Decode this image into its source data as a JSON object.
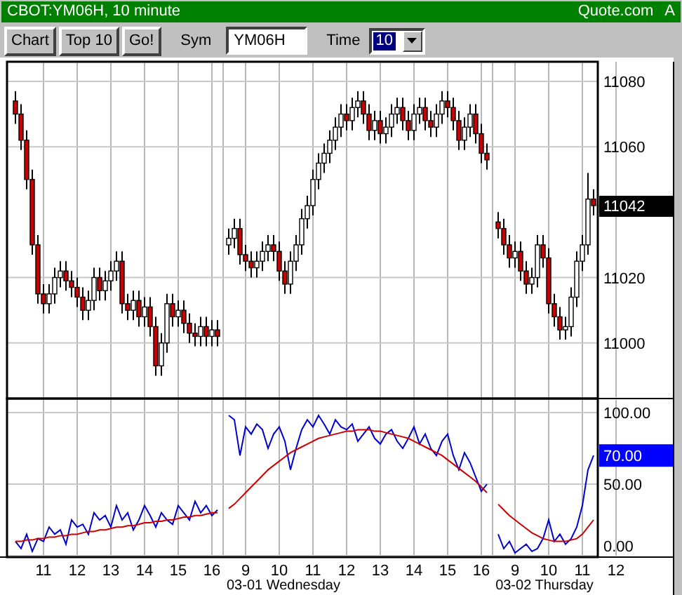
{
  "window": {
    "title": "CBOT:YM06H, 10 minute",
    "brand": "Quote.com",
    "brand_suffix": "A"
  },
  "toolbar": {
    "buttons": [
      "Chart",
      "Top 10",
      "Go!"
    ],
    "sym_label": "Sym",
    "sym_value": "YM06H",
    "time_label": "Time",
    "time_value": "10"
  },
  "price_chart": {
    "chart_data": {
      "type": "candlestick",
      "grid": true,
      "yticks": [
        11000,
        11020,
        11060,
        11080
      ],
      "ylim": [
        10983,
        11086
      ],
      "categories": [
        null,
        null,
        null,
        null,
        null,
        null,
        null,
        null,
        null,
        null,
        null,
        null,
        null,
        null,
        null,
        null,
        null,
        null,
        null,
        null,
        null,
        null,
        null,
        null,
        null,
        null,
        null,
        null,
        null,
        null,
        null,
        null,
        null,
        null,
        null,
        null,
        null,
        null,
        null,
        null,
        null,
        null,
        null,
        null,
        null,
        null,
        null,
        null,
        null,
        null,
        null,
        null,
        null,
        null,
        null,
        null,
        null,
        null,
        null,
        null,
        null,
        null,
        null,
        null,
        null,
        null,
        null,
        null,
        null,
        null,
        null,
        null,
        null,
        null,
        null,
        null,
        null,
        null,
        null,
        null,
        null,
        null,
        null,
        null,
        null,
        null,
        null,
        null,
        null,
        null,
        null,
        null,
        null,
        null,
        null,
        null,
        null,
        null,
        null,
        null,
        null,
        null,
        null,
        null,
        null,
        null,
        null,
        null
      ],
      "ohlc": [
        [
          11074,
          11077,
          11067,
          11070
        ],
        [
          11070,
          11073,
          11059,
          11062
        ],
        [
          11062,
          11065,
          11047,
          11050
        ],
        [
          11050,
          11053,
          11027,
          11030
        ],
        [
          11030,
          11033,
          11012,
          11015
        ],
        [
          11015,
          11018,
          11009,
          11012
        ],
        [
          11012,
          11018,
          11009,
          11015
        ],
        [
          11015,
          11023,
          11012,
          11020
        ],
        [
          11020,
          11025,
          11017,
          11022
        ],
        [
          11022,
          11025,
          11016,
          11019
        ],
        [
          11019,
          11022,
          11014,
          11017
        ],
        [
          11017,
          11020,
          11011,
          11014
        ],
        [
          11014,
          11017,
          11007,
          11010
        ],
        [
          11010,
          11016,
          11007,
          11013
        ],
        [
          11013,
          11023,
          11010,
          11020
        ],
        [
          11020,
          11023,
          11013,
          11016
        ],
        [
          11016,
          11022,
          11013,
          11019
        ],
        [
          11019,
          11025,
          11016,
          11022
        ],
        [
          11022,
          11028,
          11019,
          11025
        ],
        [
          11025,
          11028,
          11009,
          11012
        ],
        [
          11012,
          11015,
          11007,
          11010
        ],
        [
          11010,
          11016,
          11007,
          11013
        ],
        [
          11013,
          11016,
          11005,
          11008
        ],
        [
          11008,
          11014,
          11005,
          11011
        ],
        [
          11011,
          11014,
          11002,
          11005
        ],
        [
          11005,
          11008,
          10990,
          10993
        ],
        [
          10993,
          11003,
          10990,
          11000
        ],
        [
          11000,
          11015,
          10997,
          11012
        ],
        [
          11012,
          11015,
          11005,
          11008
        ],
        [
          11008,
          11013,
          11005,
          11010
        ],
        [
          11010,
          11013,
          11003,
          11006
        ],
        [
          11006,
          11009,
          11000,
          11003
        ],
        [
          11003,
          11006,
          10999,
          11002
        ],
        [
          11002,
          11008,
          10999,
          11005
        ],
        [
          11005,
          11008,
          10999,
          11002
        ],
        [
          11002,
          11007,
          10999,
          11004
        ],
        [
          11004,
          11007,
          10999,
          11002
        ],
        null,
        [
          11030,
          11035,
          11027,
          11032
        ],
        [
          11032,
          11038,
          11029,
          11035
        ],
        [
          11035,
          11038,
          11024,
          11027
        ],
        [
          11027,
          11030,
          11022,
          11025
        ],
        [
          11025,
          11028,
          11020,
          11023
        ],
        [
          11023,
          11028,
          11020,
          11025
        ],
        [
          11025,
          11031,
          11022,
          11028
        ],
        [
          11028,
          11033,
          11025,
          11030
        ],
        [
          11030,
          11033,
          11025,
          11028
        ],
        [
          11028,
          11031,
          11019,
          11022
        ],
        [
          11022,
          11025,
          11015,
          11018
        ],
        [
          11018,
          11028,
          11015,
          11025
        ],
        [
          11025,
          11033,
          11022,
          11030
        ],
        [
          11030,
          11041,
          11027,
          11038
        ],
        [
          11038,
          11045,
          11035,
          11042
        ],
        [
          11042,
          11053,
          11039,
          11050
        ],
        [
          11050,
          11058,
          11047,
          11055
        ],
        [
          11055,
          11061,
          11052,
          11058
        ],
        [
          11058,
          11065,
          11055,
          11062
        ],
        [
          11062,
          11069,
          11059,
          11066
        ],
        [
          11066,
          11073,
          11063,
          11070
        ],
        [
          11070,
          11073,
          11065,
          11068
        ],
        [
          11068,
          11075,
          11065,
          11072
        ],
        [
          11072,
          11077,
          11069,
          11074
        ],
        [
          11074,
          11077,
          11067,
          11070
        ],
        [
          11070,
          11073,
          11062,
          11065
        ],
        [
          11065,
          11071,
          11062,
          11068
        ],
        [
          11068,
          11071,
          11061,
          11064
        ],
        [
          11064,
          11069,
          11061,
          11066
        ],
        [
          11066,
          11073,
          11063,
          11070
        ],
        [
          11070,
          11075,
          11067,
          11072
        ],
        [
          11072,
          11075,
          11065,
          11068
        ],
        [
          11068,
          11071,
          11062,
          11065
        ],
        [
          11065,
          11073,
          11062,
          11070
        ],
        [
          11070,
          11075,
          11067,
          11072
        ],
        [
          11072,
          11075,
          11065,
          11068
        ],
        [
          11068,
          11071,
          11063,
          11066
        ],
        [
          11066,
          11073,
          11063,
          11070
        ],
        [
          11070,
          11077,
          11067,
          11074
        ],
        [
          11074,
          11077,
          11069,
          11072
        ],
        [
          11072,
          11075,
          11065,
          11068
        ],
        [
          11068,
          11071,
          11059,
          11062
        ],
        [
          11062,
          11069,
          11059,
          11066
        ],
        [
          11066,
          11073,
          11063,
          11070
        ],
        [
          11070,
          11073,
          11061,
          11064
        ],
        [
          11064,
          11067,
          11055,
          11058
        ],
        [
          11058,
          11061,
          11053,
          11056
        ],
        null,
        [
          11037,
          11040,
          11032,
          11035
        ],
        [
          11035,
          11038,
          11027,
          11030
        ],
        [
          11030,
          11033,
          11023,
          11026
        ],
        [
          11026,
          11031,
          11023,
          11028
        ],
        [
          11028,
          11031,
          11019,
          11022
        ],
        [
          11022,
          11025,
          11015,
          11018
        ],
        [
          11018,
          11023,
          11015,
          11020
        ],
        [
          11020,
          11033,
          11017,
          11030
        ],
        [
          11030,
          11033,
          11023,
          11026
        ],
        [
          11026,
          11029,
          11009,
          11012
        ],
        [
          11012,
          11015,
          11005,
          11008
        ],
        [
          11008,
          11011,
          11001,
          11004
        ],
        [
          11004,
          11008,
          11001,
          11005
        ],
        [
          11005,
          11017,
          11002,
          11014
        ],
        [
          11014,
          11028,
          11011,
          11025
        ],
        [
          11025,
          11033,
          11022,
          11030
        ],
        [
          11030,
          11052,
          11027,
          11044
        ],
        [
          11044,
          11047,
          11039,
          11042
        ],
        null,
        null,
        null,
        null
      ]
    },
    "last_price": "11042"
  },
  "indicator_chart": {
    "chart_data": {
      "type": "line",
      "grid": true,
      "ylim": [
        0,
        100
      ],
      "yticks": [
        {
          "value": 0,
          "label": "0.00"
        },
        {
          "value": 50,
          "label": "50.00"
        },
        {
          "value": 100,
          "label": "100.00"
        }
      ],
      "categories": [
        null,
        null,
        null,
        null,
        null,
        "11",
        null,
        null,
        null,
        null,
        null,
        "12",
        null,
        null,
        null,
        null,
        null,
        "13",
        null,
        null,
        null,
        null,
        null,
        "14",
        null,
        null,
        null,
        null,
        null,
        "15",
        null,
        null,
        null,
        null,
        null,
        "16",
        null,
        null,
        null,
        null,
        null,
        "9",
        null,
        null,
        null,
        null,
        null,
        "10",
        null,
        null,
        null,
        null,
        null,
        "11",
        null,
        null,
        null,
        null,
        null,
        "12",
        null,
        null,
        null,
        null,
        null,
        "13",
        null,
        null,
        null,
        null,
        null,
        "14",
        null,
        null,
        null,
        null,
        null,
        "15",
        null,
        null,
        null,
        null,
        null,
        "16",
        null,
        null,
        null,
        null,
        null,
        "9",
        null,
        null,
        null,
        null,
        null,
        "10",
        null,
        null,
        null,
        null,
        null,
        "11",
        null,
        null,
        null,
        null,
        null,
        "12"
      ],
      "series": [
        {
          "color": "#0000cc",
          "values": [
            10,
            5,
            15,
            3,
            12,
            10,
            20,
            15,
            18,
            8,
            25,
            20,
            22,
            15,
            30,
            25,
            28,
            20,
            35,
            25,
            30,
            18,
            25,
            35,
            28,
            20,
            30,
            25,
            22,
            35,
            30,
            25,
            38,
            30,
            35,
            28,
            32,
            null,
            98,
            95,
            70,
            90,
            85,
            92,
            88,
            75,
            85,
            90,
            80,
            60,
            75,
            88,
            95,
            90,
            98,
            92,
            85,
            95,
            90,
            88,
            92,
            80,
            85,
            90,
            82,
            78,
            85,
            88,
            80,
            75,
            82,
            90,
            78,
            85,
            75,
            70,
            80,
            85,
            70,
            60,
            72,
            65,
            55,
            45,
            50,
            null,
            15,
            5,
            10,
            2,
            5,
            8,
            3,
            5,
            12,
            25,
            10,
            15,
            8,
            12,
            20,
            35,
            60,
            70,
            null,
            null,
            null,
            null
          ]
        },
        {
          "color": "#cc0000",
          "values": [
            10,
            10,
            11,
            11,
            12,
            12,
            13,
            13,
            14,
            14,
            15,
            15,
            16,
            17,
            17,
            18,
            18,
            19,
            20,
            20,
            21,
            21,
            22,
            23,
            23,
            24,
            24,
            25,
            25,
            26,
            27,
            27,
            28,
            28,
            29,
            30,
            30,
            null,
            33,
            36,
            40,
            44,
            48,
            52,
            56,
            60,
            63,
            66,
            69,
            72,
            74,
            76,
            78,
            80,
            82,
            83,
            84,
            85,
            86,
            87,
            87,
            88,
            88,
            88,
            87,
            87,
            86,
            85,
            84,
            83,
            82,
            80,
            78,
            76,
            74,
            72,
            70,
            67,
            64,
            61,
            58,
            55,
            52,
            48,
            44,
            null,
            36,
            32,
            28,
            25,
            22,
            19,
            16,
            14,
            12,
            11,
            10,
            10,
            10,
            11,
            12,
            15,
            20,
            25,
            null,
            null,
            null,
            null
          ]
        }
      ]
    },
    "last_value": "70.00"
  },
  "time_axis": {
    "days": [
      "03-01 Wednesday",
      "03-02 Thursday"
    ]
  }
}
